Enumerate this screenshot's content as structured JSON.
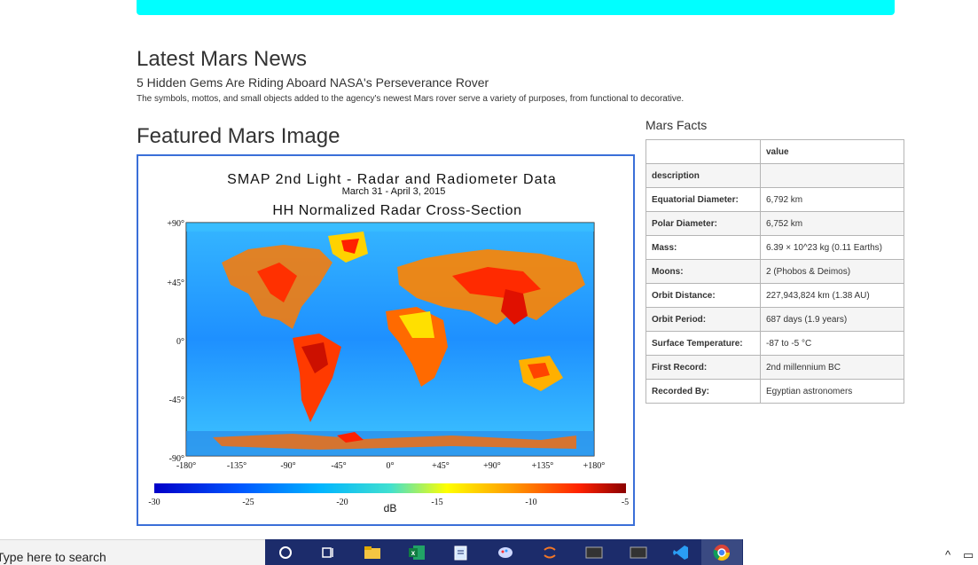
{
  "news": {
    "heading": "Latest Mars News",
    "title": "5 Hidden Gems Are Riding Aboard NASA's Perseverance Rover",
    "teaser": "The symbols, mottos, and small objects added to the agency's newest Mars rover serve a variety of purposes, from functional to decorative."
  },
  "featured": {
    "heading": "Featured Mars Image",
    "image": {
      "title": "SMAP 2nd Light - Radar and Radiometer Data",
      "dates": "March 31 - April 3, 2015",
      "subtitle": "HH Normalized Radar Cross-Section",
      "lat_labels": [
        "+90°",
        "+45°",
        "0°",
        "-45°",
        "-90°"
      ],
      "lon_labels": [
        "-180°",
        "-135°",
        "-90°",
        "-45°",
        "0°",
        "+45°",
        "+90°",
        "+135°",
        "+180°"
      ],
      "colorbar_ticks": [
        "-30",
        "-25",
        "-20",
        "-15",
        "-10",
        "-5"
      ],
      "colorbar_unit": "dB",
      "colors": [
        "#0000c8",
        "#0055ff",
        "#00b4ff",
        "#40e0d0",
        "#ffff00",
        "#ff9900",
        "#ff2200",
        "#8b0000"
      ]
    }
  },
  "facts": {
    "label": "Mars Facts",
    "header": [
      "",
      "value"
    ],
    "rows": [
      {
        "name": "description",
        "value": ""
      },
      {
        "name": "Equatorial Diameter:",
        "value": "6,792 km"
      },
      {
        "name": "Polar Diameter:",
        "value": "6,752 km"
      },
      {
        "name": "Mass:",
        "value": "6.39 × 10^23 kg (0.11 Earths)"
      },
      {
        "name": "Moons:",
        "value": "2 (Phobos & Deimos)"
      },
      {
        "name": "Orbit Distance:",
        "value": "227,943,824 km (1.38 AU)"
      },
      {
        "name": "Orbit Period:",
        "value": "687 days (1.9 years)"
      },
      {
        "name": "Surface Temperature:",
        "value": "-87 to -5 °C"
      },
      {
        "name": "First Record:",
        "value": "2nd millennium BC"
      },
      {
        "name": "Recorded By:",
        "value": "Egyptian astronomers"
      }
    ]
  },
  "taskbar": {
    "search_placeholder": "Type here to search",
    "apps": [
      "cortana-icon",
      "task-view-icon",
      "file-explorer-icon",
      "excel-icon",
      "notepad-icon",
      "paint-icon",
      "jupyter-icon",
      "terminal-icon",
      "terminal-icon",
      "vscode-icon",
      "chrome-icon"
    ],
    "tray": [
      "chevron-up-icon",
      "network-icon"
    ]
  }
}
